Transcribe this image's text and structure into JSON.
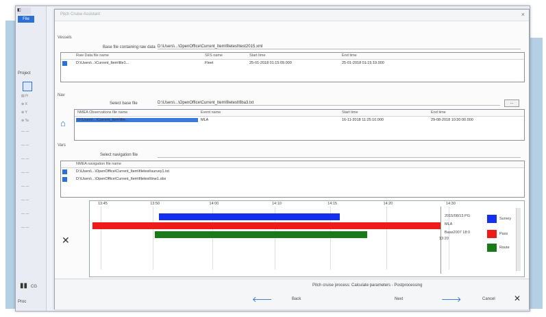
{
  "colors": {
    "accent": "#2c6fd6",
    "survey": "#1430ee",
    "pass": "#ee1b1b",
    "route": "#1a7a1a",
    "arrow": "#2c6fd6"
  },
  "app": {
    "file_tab": "File",
    "project_label": "Project",
    "status_label": "Proc",
    "left_bottom": "CG"
  },
  "window": {
    "title": "Pitch Cruise Assistant",
    "close": "×"
  },
  "section1": {
    "heading": "Vessels",
    "field_label": "Base file containing raw data",
    "field_value": "D:\\Users\\...\\OpenOffice\\Current_Item\\filetest\\test2015.xml",
    "columns": [
      "Raw Data file name",
      "SFS name",
      "Start time",
      "End time"
    ],
    "rows": [
      [
        "D:\\Users\\...\\Current_Item\\file1...",
        "Fleet",
        "25-01-2018 01:15:09.000",
        "25-01-2018 01:15:19.000"
      ]
    ]
  },
  "section2": {
    "heading": "Nav",
    "field_label": "Select base file",
    "field_value": "D:\\Users\\...\\OpenOffice\\Current_Item\\filetest\\fiba3.txt",
    "browse": "...",
    "columns": [
      "NMEA Observations file name",
      "Event name",
      "Start time",
      "End time"
    ],
    "rows": [
      [
        "D:\\Users\\...\\Current_Item\\file...",
        "MLA",
        "16-11-2018 11:25:10.000",
        "29-08-2018 10:30:00.000"
      ]
    ]
  },
  "section3": {
    "heading": "Vars",
    "field_label": "Select navigation file",
    "columns": [
      "NMEA navigation file name"
    ],
    "rows": [
      [
        "D:\\Users\\...\\OpenOffice\\Current_Item\\filetest\\survey1.txt"
      ],
      [
        "D:\\Users\\...\\OpenOffice\\Current_Item\\filetest\\line1.obs"
      ]
    ]
  },
  "chart_data": {
    "type": "gantt",
    "ticks": [
      "13:45",
      "13:50",
      "14:00",
      "14:10",
      "14:15",
      "14:20",
      "14:30"
    ],
    "series": [
      {
        "name": "Survey",
        "start": 0.19,
        "end": 0.71
      },
      {
        "name": "Pass",
        "start": 0.0,
        "end": 1.0
      },
      {
        "name": "Route",
        "start": 0.18,
        "end": 0.79
      }
    ],
    "annotations": [
      "2015/08/13 PG",
      "MLA",
      "Base2007 18:0",
      "13:20"
    ]
  },
  "footer": {
    "status": "Pitch cruise process: Calculate parameters - Postprocessing",
    "back": "Back",
    "next": "Next",
    "cancel": "Cancel"
  }
}
